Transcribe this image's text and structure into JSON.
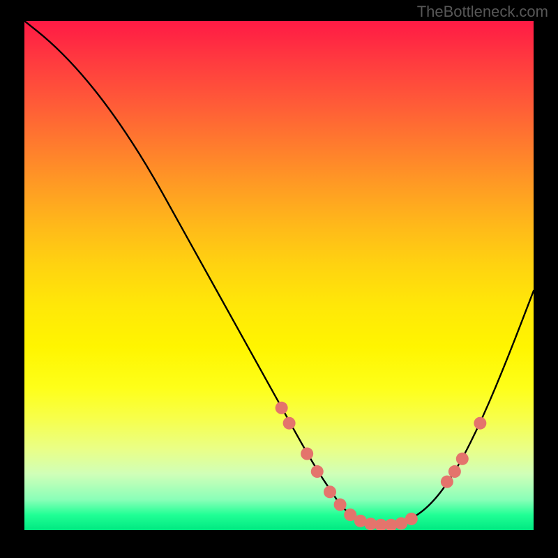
{
  "watermark": "TheBottleneck.com",
  "chart_data": {
    "type": "line",
    "title": "",
    "xlabel": "",
    "ylabel": "",
    "xlim": [
      0,
      100
    ],
    "ylim": [
      0,
      100
    ],
    "grid": false,
    "legend": false,
    "series": [
      {
        "name": "curve",
        "color": "#000000",
        "x": [
          0,
          5,
          10,
          15,
          20,
          25,
          30,
          35,
          40,
          45,
          50,
          55,
          58,
          60,
          62,
          64,
          66,
          68,
          70,
          72,
          75,
          80,
          85,
          90,
          95,
          100
        ],
        "values": [
          100,
          96,
          91,
          85,
          78,
          70,
          61,
          52,
          43,
          34,
          25,
          16,
          11,
          8,
          5,
          3,
          2,
          1.2,
          1,
          1,
          1.5,
          5,
          12,
          22,
          34,
          47
        ]
      }
    ],
    "markers": [
      {
        "x": 50.5,
        "y": 24.0
      },
      {
        "x": 52.0,
        "y": 21.0
      },
      {
        "x": 55.5,
        "y": 15.0
      },
      {
        "x": 57.5,
        "y": 11.5
      },
      {
        "x": 60.0,
        "y": 7.5
      },
      {
        "x": 62.0,
        "y": 5.0
      },
      {
        "x": 64.0,
        "y": 3.0
      },
      {
        "x": 66.0,
        "y": 1.8
      },
      {
        "x": 68.0,
        "y": 1.2
      },
      {
        "x": 70.0,
        "y": 1.0
      },
      {
        "x": 72.0,
        "y": 1.0
      },
      {
        "x": 74.0,
        "y": 1.3
      },
      {
        "x": 76.0,
        "y": 2.2
      },
      {
        "x": 83.0,
        "y": 9.5
      },
      {
        "x": 84.5,
        "y": 11.5
      },
      {
        "x": 86.0,
        "y": 14.0
      },
      {
        "x": 89.5,
        "y": 21.0
      }
    ],
    "marker_style": {
      "color": "#e4746c",
      "radius_px": 9
    },
    "gradient": {
      "direction": "top-to-bottom",
      "stops": [
        {
          "pos": 0.0,
          "color": "#ff1a45"
        },
        {
          "pos": 0.4,
          "color": "#ffb81a"
        },
        {
          "pos": 0.72,
          "color": "#feff19"
        },
        {
          "pos": 0.94,
          "color": "#8affb8"
        },
        {
          "pos": 1.0,
          "color": "#00e881"
        }
      ]
    }
  }
}
